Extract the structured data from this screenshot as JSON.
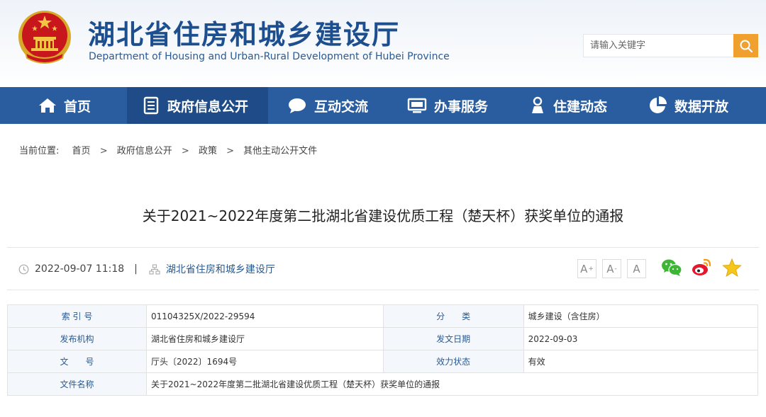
{
  "header": {
    "title_cn": "湖北省住房和城乡建设厅",
    "title_en": "Department of Housing and Urban-Rural Development of Hubei Province",
    "search_placeholder": "请输入关键字"
  },
  "nav": {
    "items": [
      {
        "label": "首页",
        "icon": "home-icon"
      },
      {
        "label": "政府信息公开",
        "icon": "document-list-icon",
        "active": true
      },
      {
        "label": "互动交流",
        "icon": "chat-bubble-icon"
      },
      {
        "label": "办事服务",
        "icon": "monitor-icon"
      },
      {
        "label": "住建动态",
        "icon": "person-icon"
      },
      {
        "label": "数据开放",
        "icon": "pie-chart-icon"
      }
    ]
  },
  "breadcrumb": {
    "label": "当前位置:",
    "items": [
      "首页",
      "政府信息公开",
      "政策",
      "其他主动公开文件"
    ]
  },
  "article": {
    "title": "关于2021~2022年度第二批湖北省建设优质工程（楚天杯）获奖单位的通报",
    "date": "2022-09-07 11:18",
    "pipe": "|",
    "source": "湖北省住房和城乡建设厅",
    "font_sizes": [
      "A",
      "A",
      "A"
    ]
  },
  "info": {
    "rows": [
      {
        "k1": "索 引 号",
        "v1": "01104325X/2022-29594",
        "k2": "分　　类",
        "v2": "城乡建设（含住房）"
      },
      {
        "k1": "发布机构",
        "v1": "湖北省住房和城乡建设厅",
        "k2": "发文日期",
        "v2": "2022-09-03"
      },
      {
        "k1": "文　　号",
        "v1": "厅头〔2022〕1694号",
        "k2": "效力状态",
        "v2": "有效"
      }
    ],
    "name_key": "文件名称",
    "name_value": "关于2021~2022年度第二批湖北省建设优质工程（楚天杯）获奖单位的通报"
  },
  "colors": {
    "nav_bg": "#2a5da0",
    "nav_active": "#1f4c88",
    "brand_blue": "#1d4f8f",
    "search_btn": "#f0a02f"
  }
}
